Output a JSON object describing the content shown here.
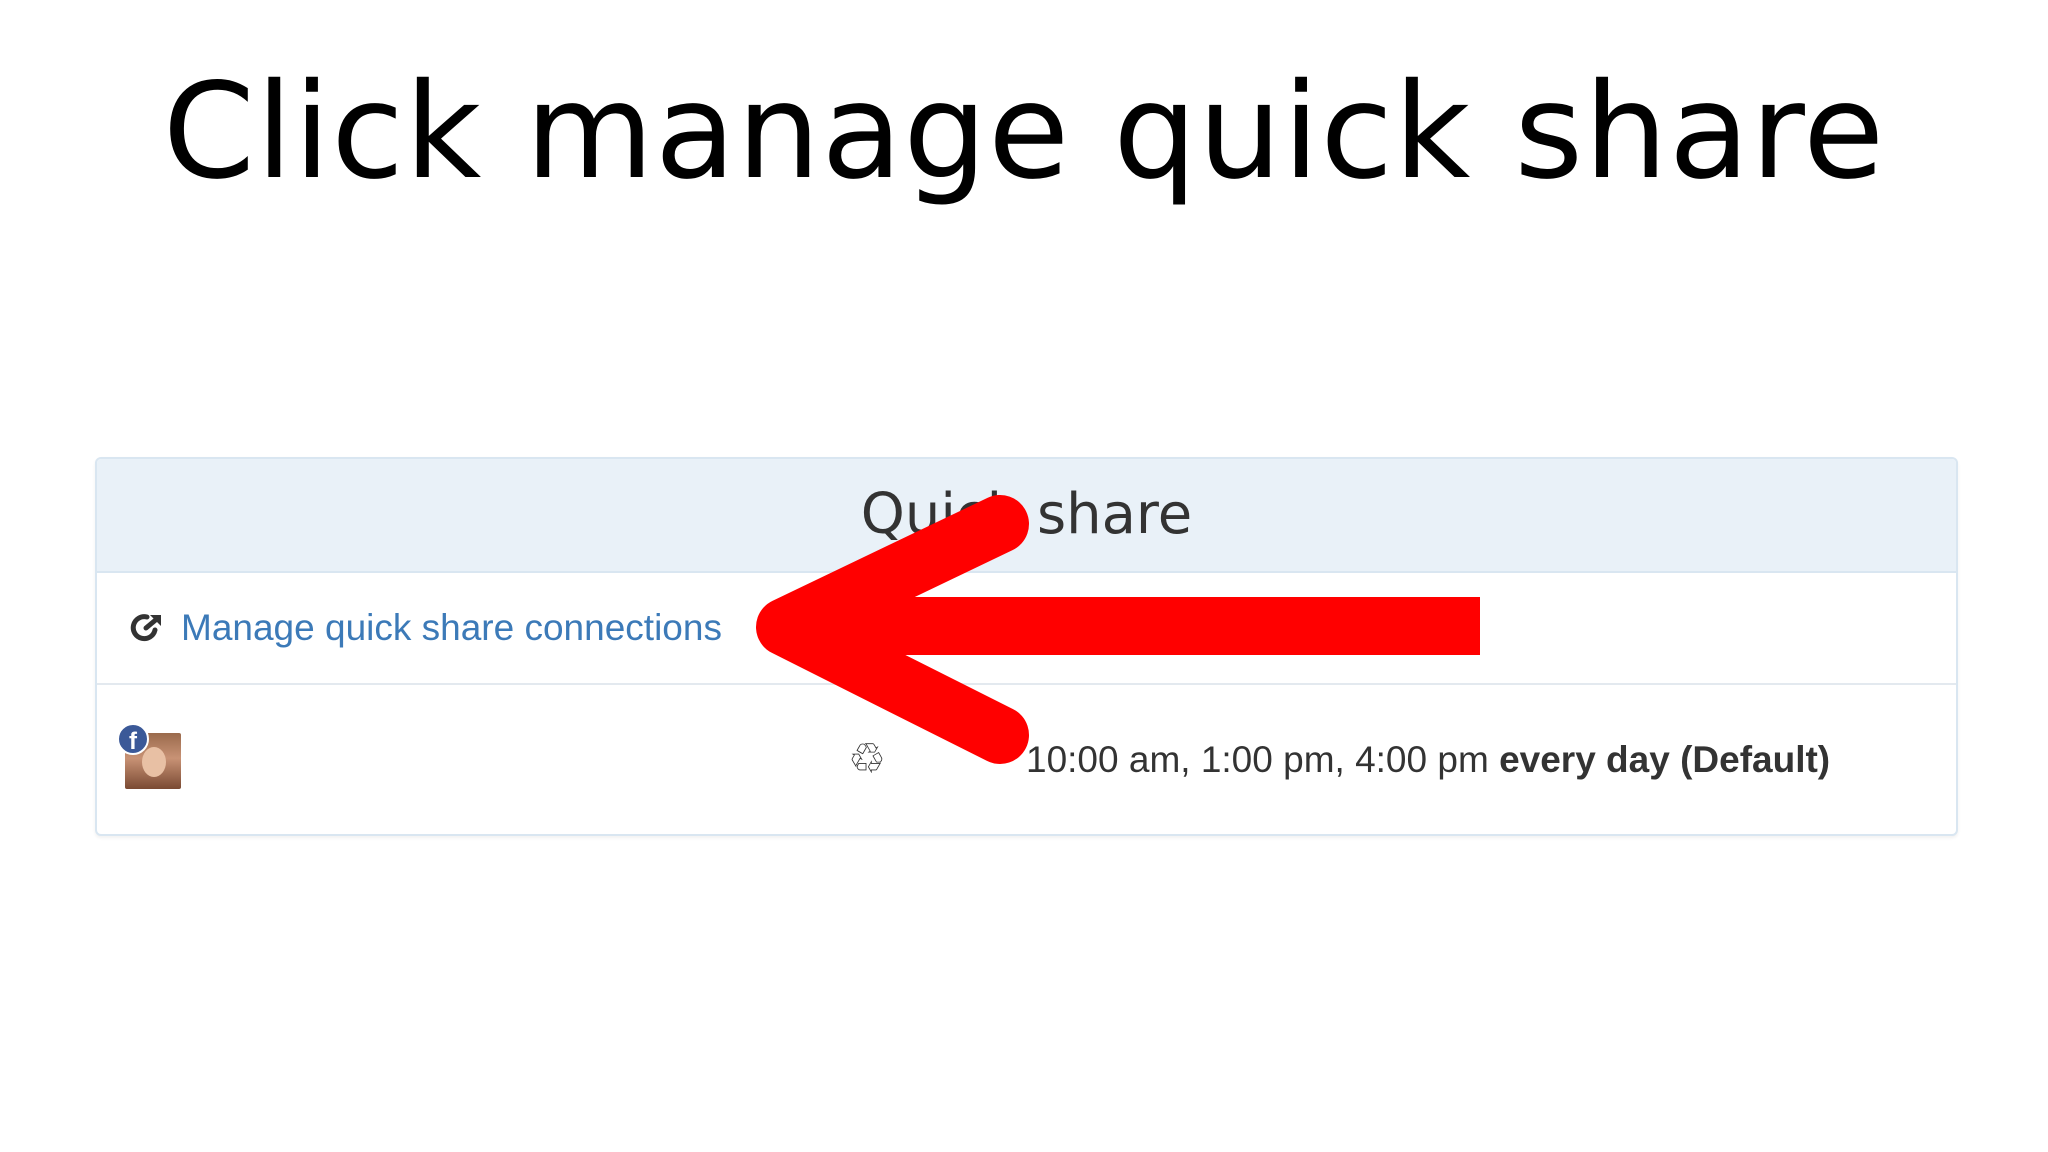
{
  "slide": {
    "title": "Click manage quick share"
  },
  "panel": {
    "header": "Quick share",
    "manage_link": "Manage quick share connections",
    "account": {
      "network": "facebook",
      "badge_glyph": "f",
      "schedule_times": "10:00 am, 1:00 pm, 4:00 pm",
      "schedule_recurrence": "every day (Default)"
    }
  },
  "icons": {
    "share": "share-icon",
    "recycle": "recycle-icon",
    "recycle_glyph": "♲",
    "network": "facebook-icon"
  },
  "colors": {
    "arrow": "#ff0000",
    "link": "#3c7ab8",
    "header_bg": "#e9f1f8",
    "facebook": "#3b5998"
  }
}
